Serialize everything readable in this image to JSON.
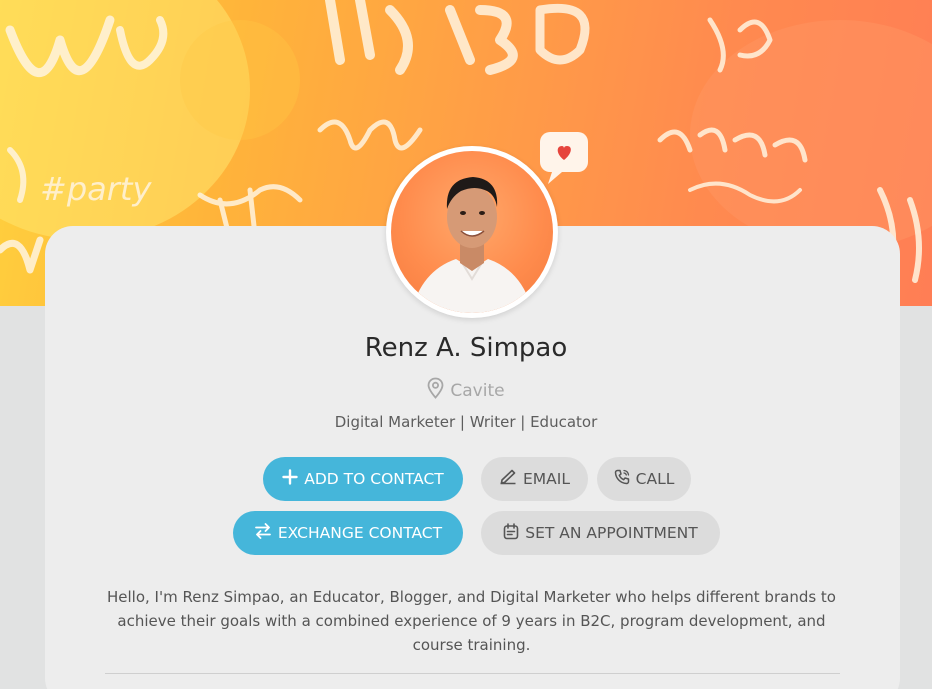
{
  "banner": {
    "words": [
      "vlog",
      "THREAD",
      "#party",
      "reels",
      "SPOILER",
      "alert",
      "story",
      "Rig"
    ],
    "colors": {
      "start": "#ffd23e",
      "end": "#ff7e55"
    }
  },
  "profile": {
    "name": "Renz A. Simpao",
    "location": "Cavite",
    "tagline": "Digital Marketer | Writer | Educator",
    "bio": "Hello, I'm Renz Simpao, an Educator, Blogger, and Digital Marketer who helps different brands to achieve their goals with a combined experience of 9 years in B2C, program development, and course training."
  },
  "actions": {
    "add_to_contact": "ADD TO CONTACT",
    "email": "EMAIL",
    "call": "CALL",
    "exchange_contact": "EXCHANGE CONTACT",
    "set_appointment": "SET AN APPOINTMENT"
  },
  "icons": {
    "location": "map-pin-icon",
    "add": "plus-icon",
    "email": "send-icon",
    "call": "phone-icon",
    "exchange": "swap-arrows-icon",
    "appointment": "calendar-icon"
  },
  "theme": {
    "primary_button": "#45b6da",
    "secondary_button": "#dcdcdc",
    "card": "#ededed"
  }
}
